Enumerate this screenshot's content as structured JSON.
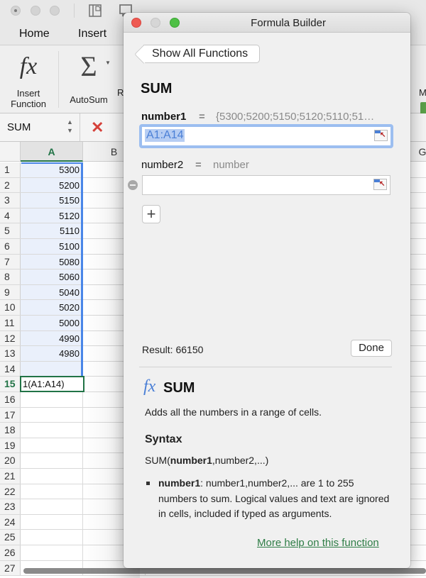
{
  "excel": {
    "window_controls": [
      "close",
      "minimize",
      "zoom"
    ],
    "quick_access_icons": [
      "sidebar-icon",
      "save-icon",
      "undo-icon",
      "redo-icon"
    ],
    "ribbon_tabs": [
      "Home",
      "Insert"
    ],
    "ribbon_buttons": [
      {
        "icon": "fx-icon",
        "glyph": "fx",
        "label_line1": "Insert",
        "label_line2": "Function"
      },
      {
        "icon": "sigma-icon",
        "glyph": "Σ",
        "label_line1": "AutoSum",
        "label_line2": ""
      }
    ],
    "ribbon_partial_labels": {
      "after_autosum": "R",
      "far_right": "M"
    },
    "name_box": "SUM",
    "cancel_glyph": "✕",
    "columns": [
      "A",
      "B"
    ],
    "partial_column": "G",
    "rows": [
      {
        "n": "1",
        "a": "5300"
      },
      {
        "n": "2",
        "a": "5200"
      },
      {
        "n": "3",
        "a": "5150"
      },
      {
        "n": "4",
        "a": "5120"
      },
      {
        "n": "5",
        "a": "5110"
      },
      {
        "n": "6",
        "a": "5100"
      },
      {
        "n": "7",
        "a": "5080"
      },
      {
        "n": "8",
        "a": "5060"
      },
      {
        "n": "9",
        "a": "5040"
      },
      {
        "n": "10",
        "a": "5020"
      },
      {
        "n": "11",
        "a": "5000"
      },
      {
        "n": "12",
        "a": "4990"
      },
      {
        "n": "13",
        "a": "4980"
      },
      {
        "n": "14",
        "a": ""
      },
      {
        "n": "15",
        "a": "1(A1:A14)"
      },
      {
        "n": "16",
        "a": ""
      },
      {
        "n": "17",
        "a": ""
      },
      {
        "n": "18",
        "a": ""
      },
      {
        "n": "19",
        "a": ""
      },
      {
        "n": "20",
        "a": ""
      },
      {
        "n": "21",
        "a": ""
      },
      {
        "n": "22",
        "a": ""
      },
      {
        "n": "23",
        "a": ""
      },
      {
        "n": "24",
        "a": ""
      },
      {
        "n": "25",
        "a": ""
      },
      {
        "n": "26",
        "a": ""
      },
      {
        "n": "27",
        "a": ""
      }
    ],
    "active_row": "15",
    "active_cell_content": "1(A1:A14)"
  },
  "formula_builder": {
    "title": "Formula Builder",
    "back_button": "Show All Functions",
    "function_name": "SUM",
    "args": [
      {
        "name": "number1",
        "eq": "=",
        "value": "{5300;5200;5150;5120;5110;51…",
        "input": "A1:A14"
      },
      {
        "name": "number2",
        "eq": "=",
        "value": "number",
        "input": ""
      }
    ],
    "add_arg_glyph": "+",
    "result_label": "Result: 66150",
    "done_label": "Done",
    "help": {
      "fx_glyph": "fx",
      "title": "SUM",
      "description": "Adds all the numbers in a range of cells.",
      "syntax_heading": "Syntax",
      "syntax_prefix": "SUM(",
      "syntax_bold": "number1",
      "syntax_suffix": ",number2,...)",
      "arg_name": "number1",
      "arg_desc": ": number1,number2,... are 1 to 255 numbers to sum. Logical values and text are ignored in cells, included if typed as arguments.",
      "more_help_link": "More help on this function"
    }
  }
}
